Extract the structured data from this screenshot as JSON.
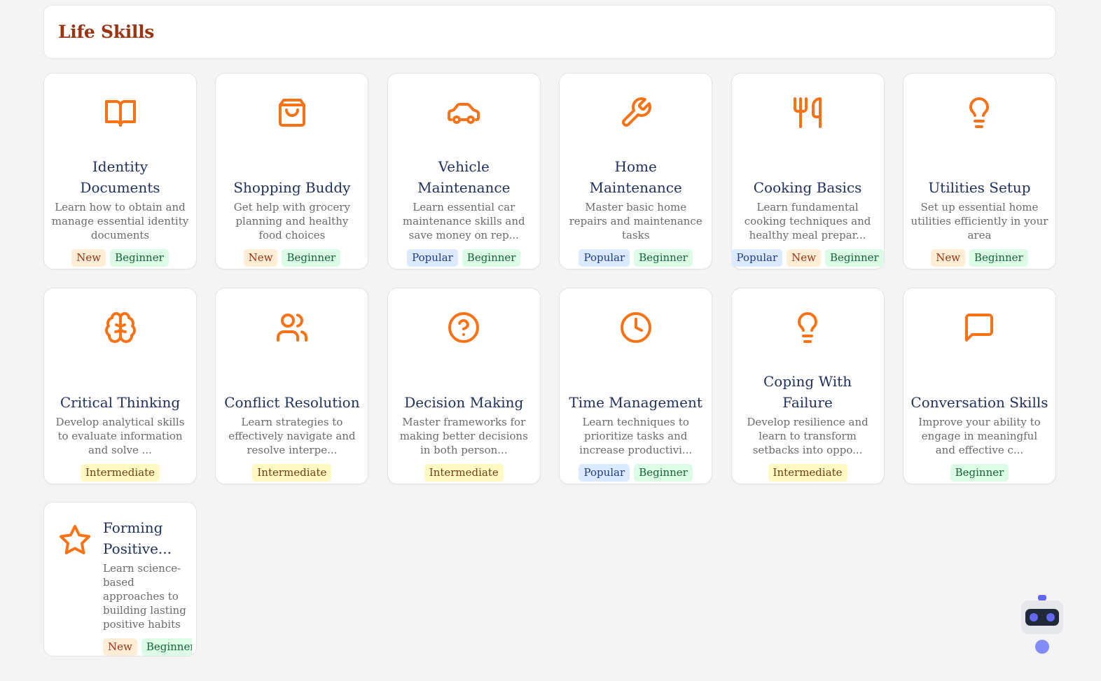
{
  "header": {
    "title": "Life Skills"
  },
  "cards": [
    {
      "icon": "book-open-icon",
      "title": "Identity Documents",
      "desc": "Learn how to obtain and manage essential identity documents",
      "tags": [
        {
          "label": "New",
          "kind": "new"
        },
        {
          "label": "Beginner",
          "kind": "beginner"
        }
      ]
    },
    {
      "icon": "shopping-bag-icon",
      "title": "Shopping Buddy",
      "desc": "Get help with grocery planning and healthy food choices",
      "tags": [
        {
          "label": "New",
          "kind": "new"
        },
        {
          "label": "Beginner",
          "kind": "beginner"
        }
      ]
    },
    {
      "icon": "car-icon",
      "title": "Vehicle Maintenance",
      "desc": "Learn essential car maintenance skills and save money on rep...",
      "tags": [
        {
          "label": "Popular",
          "kind": "popular"
        },
        {
          "label": "Beginner",
          "kind": "beginner"
        }
      ]
    },
    {
      "icon": "wrench-icon",
      "title": "Home Maintenance",
      "desc": "Master basic home repairs and maintenance tasks",
      "tags": [
        {
          "label": "Popular",
          "kind": "popular"
        },
        {
          "label": "Beginner",
          "kind": "beginner"
        }
      ]
    },
    {
      "icon": "utensils-icon",
      "title": "Cooking Basics",
      "desc": "Learn fundamental cooking techniques and healthy meal prepar...",
      "tags": [
        {
          "label": "Popular",
          "kind": "popular"
        },
        {
          "label": "New",
          "kind": "new"
        },
        {
          "label": "Beginner",
          "kind": "beginner"
        }
      ]
    },
    {
      "icon": "lightbulb-icon",
      "title": "Utilities Setup",
      "desc": "Set up essential home utilities efficiently in your area",
      "tags": [
        {
          "label": "New",
          "kind": "new"
        },
        {
          "label": "Beginner",
          "kind": "beginner"
        }
      ]
    },
    {
      "icon": "brain-icon",
      "title": "Critical Thinking",
      "desc": "Develop analytical skills to evaluate information and solve ...",
      "tags": [
        {
          "label": "Intermediate",
          "kind": "intermediate"
        }
      ]
    },
    {
      "icon": "users-icon",
      "title": "Conflict Resolution",
      "desc": "Learn strategies to effectively navigate and resolve interpe...",
      "tags": [
        {
          "label": "Intermediate",
          "kind": "intermediate"
        }
      ]
    },
    {
      "icon": "help-circle-icon",
      "title": "Decision Making",
      "desc": "Master frameworks for making better decisions in both person...",
      "tags": [
        {
          "label": "Intermediate",
          "kind": "intermediate"
        }
      ]
    },
    {
      "icon": "clock-icon",
      "title": "Time Management",
      "desc": "Learn techniques to prioritize tasks and increase productivi...",
      "tags": [
        {
          "label": "Popular",
          "kind": "popular"
        },
        {
          "label": "Beginner",
          "kind": "beginner"
        }
      ]
    },
    {
      "icon": "lightbulb-icon",
      "title": "Coping With Failure",
      "desc": "Develop resilience and learn to transform setbacks into oppo...",
      "tags": [
        {
          "label": "Intermediate",
          "kind": "intermediate"
        }
      ]
    },
    {
      "icon": "message-square-icon",
      "title": "Conversation Skills",
      "desc": "Improve your ability to engage in meaningful and effective c...",
      "tags": [
        {
          "label": "Beginner",
          "kind": "beginner"
        }
      ]
    }
  ],
  "last_card": {
    "icon": "star-icon",
    "title": "Forming Positive...",
    "desc": "Learn science-based approaches to building lasting positive habits",
    "tags": [
      {
        "label": "New",
        "kind": "new"
      },
      {
        "label": "Beginner",
        "kind": "beginner"
      }
    ]
  },
  "assistant": {
    "icon": "robot-icon"
  },
  "colors": {
    "accent": "#f97316",
    "title": "#9a3412",
    "card_title": "#1e2f5c"
  }
}
